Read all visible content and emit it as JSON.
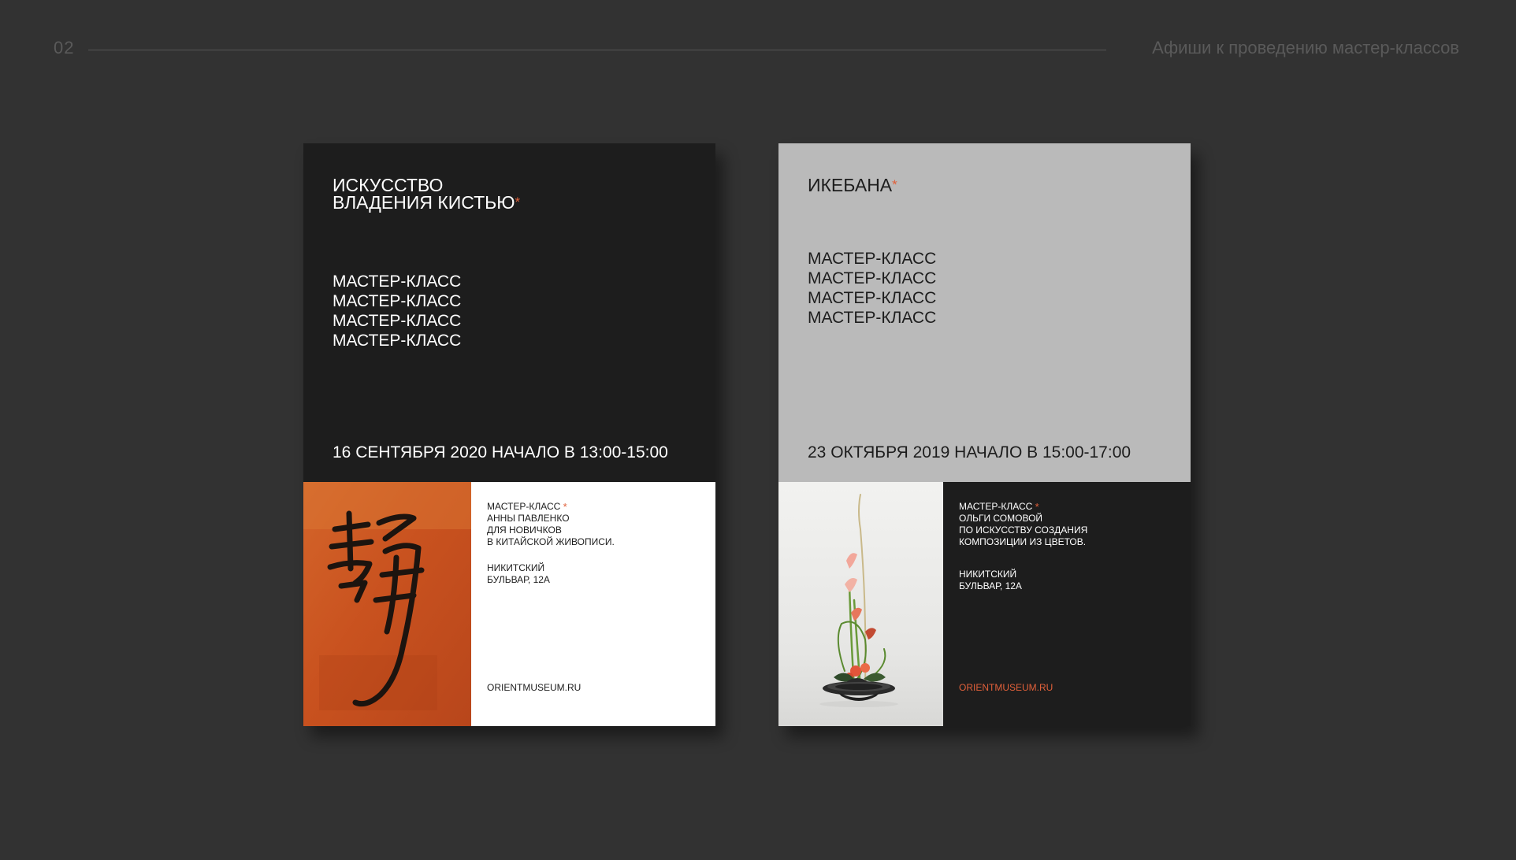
{
  "header": {
    "page_number": "02",
    "title": "Афиши к проведению мастер-классов"
  },
  "colors": {
    "background": "#323232",
    "poster_dark": "#1d1d1d",
    "poster_light": "#bababa",
    "accent": "#e0603a"
  },
  "posters": [
    {
      "title_line1": "ИСКУССТВО",
      "title_line2": "ВЛАДЕНИЯ КИСТЬЮ",
      "title_mark": "*",
      "classes": [
        "МАСТЕР-КЛАСС",
        "МАСТЕР-КЛАСС",
        "МАСТЕР-КЛАСС",
        "МАСТЕР-КЛАСС"
      ],
      "date": "16 СЕНТЯБРЯ 2020 НАЧАЛО В 13:00-15:00",
      "image": "calligraphy-on-orange-painting",
      "desc_line1": "МАСТЕР-КЛАСС",
      "desc_mark": "*",
      "desc_line2": "АННЫ ПАВЛЕНКО",
      "desc_line3": "ДЛЯ НОВИЧКОВ",
      "desc_line4": "В КИТАЙСКОЙ ЖИВОПИСИ.",
      "addr_line1": "НИКИТСКИЙ",
      "addr_line2": "БУЛЬВАР, 12А",
      "url": "ORIENTMUSEUM.RU"
    },
    {
      "title_line1": "ИКЕБАНА",
      "title_mark": "*",
      "classes": [
        "МАСТЕР-КЛАСС",
        "МАСТЕР-КЛАСС",
        "МАСТЕР-КЛАСС",
        "МАСТЕР-КЛАСС"
      ],
      "date": "23 ОКТЯБРЯ 2019 НАЧАЛО В 15:00-17:00",
      "image": "ikebana-flower-arrangement",
      "desc_line1": "МАСТЕР-КЛАСС",
      "desc_mark": "*",
      "desc_line2": "ОЛЬГИ СОМОВОЙ",
      "desc_line3": "ПО ИСКУССТВУ СОЗДАНИЯ",
      "desc_line4": "КОМПОЗИЦИИ ИЗ ЦВЕТОВ.",
      "addr_line1": "НИКИТСКИЙ",
      "addr_line2": "БУЛЬВАР, 12А",
      "url": "ORIENTMUSEUM.RU"
    }
  ]
}
